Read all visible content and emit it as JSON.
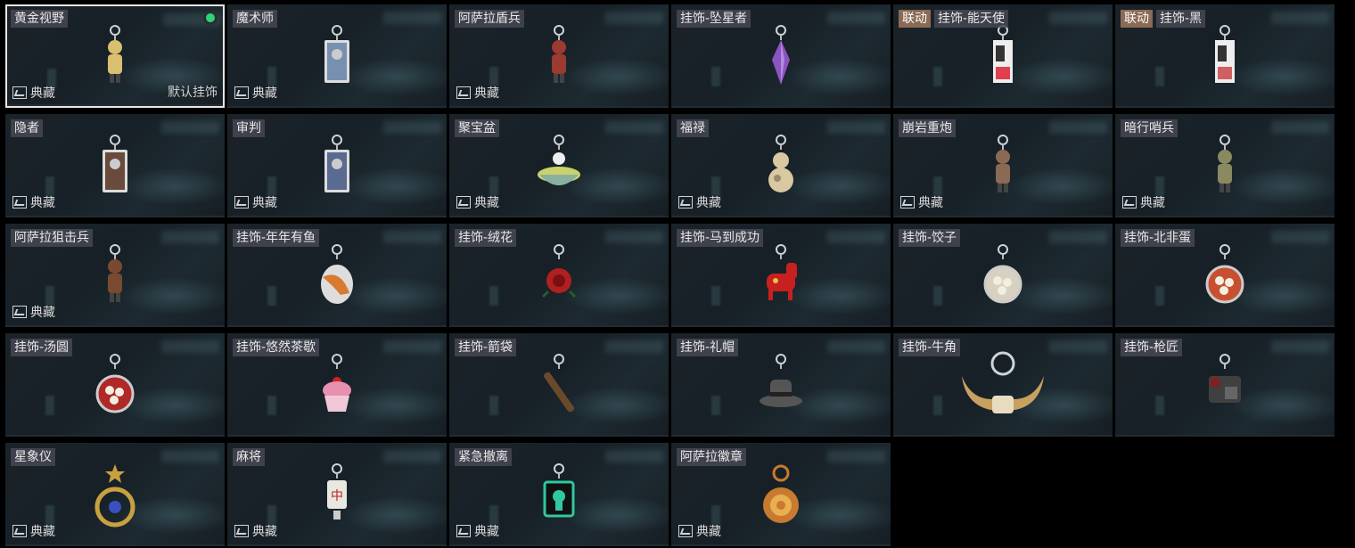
{
  "collection_label": "典藏",
  "default_label": "默认挂饰",
  "collab_label": "联动",
  "items": [
    {
      "name": "黄金视野",
      "collection": true,
      "selected": true,
      "equipped": true,
      "icon": "golden-vision-charm-icon",
      "charm": "figure",
      "color": "#d9c070"
    },
    {
      "name": "魔术师",
      "collection": true,
      "icon": "magician-card-charm-icon",
      "charm": "card",
      "color": "#7890b0"
    },
    {
      "name": "阿萨拉盾兵",
      "collection": true,
      "icon": "shield-soldier-charm-icon",
      "charm": "figure",
      "color": "#9a3a30"
    },
    {
      "name": "挂饰-坠星者",
      "collection": false,
      "icon": "purple-crystal-charm-icon",
      "charm": "crystal",
      "color": "#8a55c0"
    },
    {
      "name": "挂饰-能天使",
      "collection": false,
      "collab": true,
      "icon": "exusiai-charm-icon",
      "charm": "tag",
      "color": "#e04050"
    },
    {
      "name": "挂饰-黑",
      "collection": false,
      "collab": true,
      "icon": "black-charm-icon",
      "charm": "tag",
      "color": "#d06060"
    },
    {
      "name": "隐者",
      "collection": true,
      "icon": "hermit-card-charm-icon",
      "charm": "card",
      "color": "#6a4a3a"
    },
    {
      "name": "审判",
      "collection": true,
      "icon": "judgement-card-charm-icon",
      "charm": "card",
      "color": "#5a6a90"
    },
    {
      "name": "聚宝盆",
      "collection": true,
      "icon": "treasure-bowl-charm-icon",
      "charm": "bowl",
      "color": "#c9d26a"
    },
    {
      "name": "福禄",
      "collection": true,
      "icon": "gourd-charm-icon",
      "charm": "gourd",
      "color": "#d9c8a0"
    },
    {
      "name": "崩岩重炮",
      "collection": true,
      "icon": "heavy-gunner-charm-icon",
      "charm": "figure",
      "color": "#8a6a55"
    },
    {
      "name": "暗行哨兵",
      "collection": true,
      "icon": "shadow-sentry-charm-icon",
      "charm": "figure",
      "color": "#8a8a60"
    },
    {
      "name": "阿萨拉狙击兵",
      "collection": true,
      "icon": "sniper-charm-icon",
      "charm": "figure",
      "color": "#7a4a30"
    },
    {
      "name": "挂饰-年年有鱼",
      "collection": false,
      "icon": "fish-charm-icon",
      "charm": "fish",
      "color": "#d87a30"
    },
    {
      "name": "挂饰-绒花",
      "collection": false,
      "icon": "rose-charm-icon",
      "charm": "rose",
      "color": "#b02020"
    },
    {
      "name": "挂饰-马到成功",
      "collection": false,
      "icon": "horse-charm-icon",
      "charm": "horse",
      "color": "#c82020"
    },
    {
      "name": "挂饰-饺子",
      "collection": false,
      "icon": "dumpling-charm-icon",
      "charm": "plate",
      "color": "#d8d0c0"
    },
    {
      "name": "挂饰-北非蛋",
      "collection": false,
      "icon": "shakshuka-charm-icon",
      "charm": "plate",
      "color": "#c85030"
    },
    {
      "name": "挂饰-汤圆",
      "collection": false,
      "icon": "tangyuan-charm-icon",
      "charm": "plate",
      "color": "#b02828"
    },
    {
      "name": "挂饰-悠然茶歇",
      "collection": false,
      "icon": "cupcake-charm-icon",
      "charm": "cupcake",
      "color": "#e890b0"
    },
    {
      "name": "挂饰-箭袋",
      "collection": false,
      "icon": "quiver-charm-icon",
      "charm": "quiver",
      "color": "#6a4a2a"
    },
    {
      "name": "挂饰-礼帽",
      "collection": false,
      "icon": "top-hat-charm-icon",
      "charm": "hat",
      "color": "#555555"
    },
    {
      "name": "挂饰-牛角",
      "collection": false,
      "icon": "bull-horn-charm-icon",
      "charm": "horns",
      "color": "#c8a060"
    },
    {
      "name": "挂饰-枪匠",
      "collection": false,
      "icon": "gunsmith-case-charm-icon",
      "charm": "case",
      "color": "#404040"
    },
    {
      "name": "星象仪",
      "collection": true,
      "icon": "astrolabe-charm-icon",
      "charm": "astrolabe",
      "color": "#c8a040"
    },
    {
      "name": "麻将",
      "collection": true,
      "icon": "mahjong-charm-icon",
      "charm": "mahjong",
      "color": "#e8e8e0"
    },
    {
      "name": "紧急撤离",
      "collection": true,
      "icon": "emergency-evac-charm-icon",
      "charm": "sign",
      "color": "#30c8a0"
    },
    {
      "name": "阿萨拉徽章",
      "collection": true,
      "icon": "asala-badge-charm-icon",
      "charm": "badge",
      "color": "#c87a30"
    }
  ]
}
